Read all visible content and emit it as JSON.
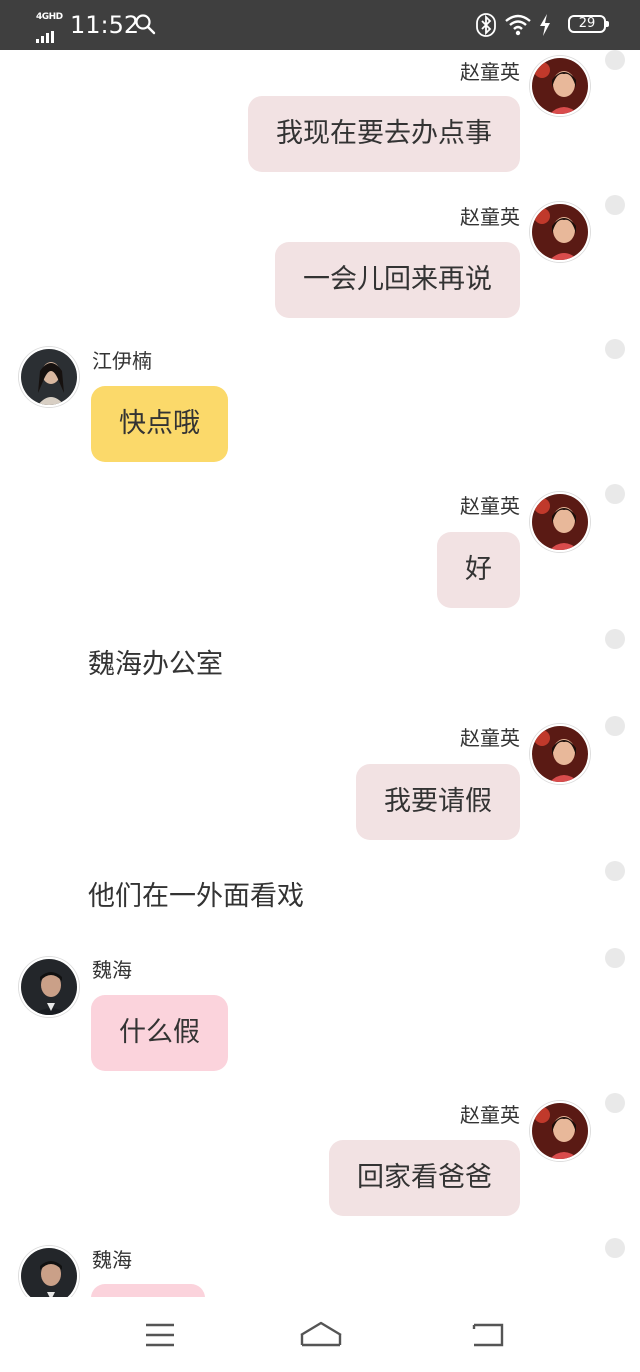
{
  "status_bar": {
    "network": "4GHD",
    "time": "11:52",
    "battery": "29",
    "background": "#3f3f3f"
  },
  "colors": {
    "own_bubble": "#f2e2e3",
    "jiang_bubble": "#fbd96a",
    "wei_bubble": "#fbd3dc"
  },
  "chat": {
    "messages": [
      {
        "sender": "赵童英",
        "text": "我现在要去办点事",
        "side": "right"
      },
      {
        "sender": "赵童英",
        "text": "一会儿回来再说",
        "side": "right"
      },
      {
        "sender": "江伊楠",
        "text": "快点哦",
        "side": "left"
      },
      {
        "sender": "赵童英",
        "text": "好",
        "side": "right"
      },
      {
        "narration": "魏海办公室"
      },
      {
        "sender": "赵童英",
        "text": "我要请假",
        "side": "right"
      },
      {
        "narration": "他们在一外面看戏"
      },
      {
        "sender": "魏海",
        "text": "什么假",
        "side": "left"
      },
      {
        "sender": "赵童英",
        "text": "回家看爸爸",
        "side": "right"
      },
      {
        "sender": "魏海",
        "text": "",
        "side": "left"
      }
    ]
  },
  "nav_bar": {
    "icons": [
      "menu-icon",
      "home-icon",
      "back-icon"
    ]
  }
}
